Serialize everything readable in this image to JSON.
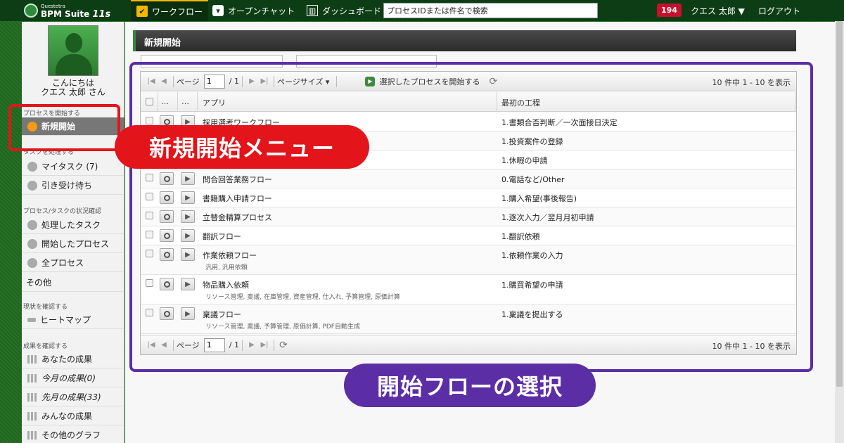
{
  "topbar": {
    "logo_small": "Questetra",
    "logo_text": "BPM Suite",
    "logo_version": "11s",
    "nav": [
      {
        "label": "ワークフロー",
        "icon": "checkbox-icon"
      },
      {
        "label": "オープンチャット",
        "icon": "chat-bubble-icon"
      },
      {
        "label": "ダッシュボード",
        "icon": "dashboard-icon"
      }
    ],
    "search_value": "プロセスIDまたは件名で検索",
    "badge_count": "194",
    "user_name": "クエス 太郎 ▼",
    "logout": "ログアウト"
  },
  "sidebar": {
    "greeting": "こんにちは",
    "user": "クエス 太郎 さん",
    "sec_start": "プロセスを開始する",
    "new_start": "新規開始",
    "sec_task": "タスクを処理する",
    "my_task": "マイタスク (7)",
    "pending": "引き受け待ち",
    "sec_status": "プロセス/タスクの状況確認",
    "done_task": "処理したタスク",
    "started_process": "開始したプロセス",
    "all_process": "全プロセス",
    "other": "その他",
    "sec_current": "現状を確認する",
    "heatmap": "ヒートマップ",
    "sec_result": "成果を確認する",
    "your_result": "あなたの成果",
    "month_result": "今月の成果(0)",
    "last_month_result": "先月の成果(33)",
    "everyone_result": "みんなの成果",
    "other_graph": "その他のグラフ"
  },
  "main": {
    "title": "新規開始",
    "pager": {
      "page_label": "ページ",
      "page_value": "1",
      "page_total": "/ 1",
      "page_size": "ページサイズ ▾",
      "start_selected": "選択したプロセスを開始する",
      "count": "10 件中 1 - 10 を表示"
    },
    "columns": {
      "dots1": "…",
      "dots2": "…",
      "app": "アプリ",
      "first_step": "最初の工程"
    },
    "rows": [
      {
        "app": "採用選考ワークフロー",
        "step": "1.書類合否判断／一次面接日決定",
        "tags": ""
      },
      {
        "app": "",
        "step": "1.投資案件の登録",
        "tags": ""
      },
      {
        "app": "",
        "step": "1.休暇の申請",
        "tags": ""
      },
      {
        "app": "問合回答業務フロー",
        "step": "0.電話など/Other",
        "tags": ""
      },
      {
        "app": "書籍購入申請フロー",
        "step": "1.購入希望(事後報告)",
        "tags": ""
      },
      {
        "app": "立替金精算プロセス",
        "step": "1.逐次入力／翌月月初申請",
        "tags": ""
      },
      {
        "app": "翻訳フロー",
        "step": "1.翻訳依頼",
        "tags": ""
      },
      {
        "app": "作業依頼フロー",
        "step": "1.依頼作業の入力",
        "tags": "汎用, 汎用依頼"
      },
      {
        "app": "物品購入依頼",
        "step": "1.購買希望の申請",
        "tags": "リソース管理, 稟議, 在庫管理, 資産管理, 仕入れ, 予算管理, 原価計算"
      },
      {
        "app": "稟議フロー",
        "step": "1.稟議を提出する",
        "tags": "リソース管理, 稟議, 予算管理, 原価計算, PDF自動生成"
      }
    ]
  },
  "callouts": {
    "menu": "新規開始メニュー",
    "flow": "開始フローの選択"
  },
  "colors": {
    "accent_red": "#e3141a",
    "accent_purple": "#5b2ea6",
    "topbar": "#0d3d14"
  }
}
